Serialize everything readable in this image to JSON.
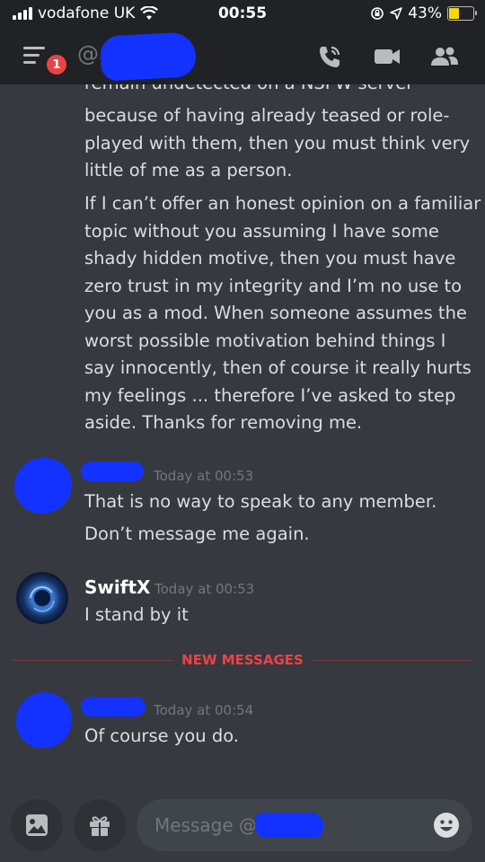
{
  "statusbar": {
    "carrier": "vodafone UK",
    "time": "00:55",
    "battery": "43%",
    "battery_level": 0.43
  },
  "header": {
    "notification_count": "1",
    "at_symbol": "@",
    "icons": [
      "menu-icon",
      "call-icon",
      "video-icon",
      "members-icon"
    ]
  },
  "messages": {
    "continued_lines": [
      "remain undetected on a NSFW server",
      "because of having already teased or role-",
      "played with them, then you must think very",
      "little of me as a person."
    ],
    "paragraph_lines": [
      "If I can’t offer an honest opinion on a familiar",
      "topic without you assuming I have some",
      "shady hidden motive, then you must have",
      "zero trust in my integrity and I’m no use to",
      "you as a mod. When someone assumes the",
      "worst possible motivation behind things I",
      "say innocently, then of course it really hurts",
      "my feelings ... therefore I’ve asked to step",
      "aside. Thanks for removing me."
    ],
    "group2": {
      "timestamp": "Today at 00:53",
      "line1": "That is no way to speak to any member.",
      "line2": "Don’t message me again."
    },
    "group3": {
      "author": "SwiftX",
      "timestamp": "Today at 00:53",
      "text": "I stand by it"
    },
    "new_messages_label": "NEW MESSAGES",
    "group4": {
      "timestamp": "Today at 00:54",
      "text": "Of course you do."
    }
  },
  "input": {
    "placeholder": "Message @",
    "buttons": [
      "image-icon",
      "gift-icon",
      "emoji-icon"
    ]
  },
  "colors": {
    "background": "#36393f",
    "header": "#202225",
    "text": "#dcddde",
    "timestamp": "#72767d",
    "new_messages": "#ed4245",
    "redaction": "#1332ff"
  }
}
